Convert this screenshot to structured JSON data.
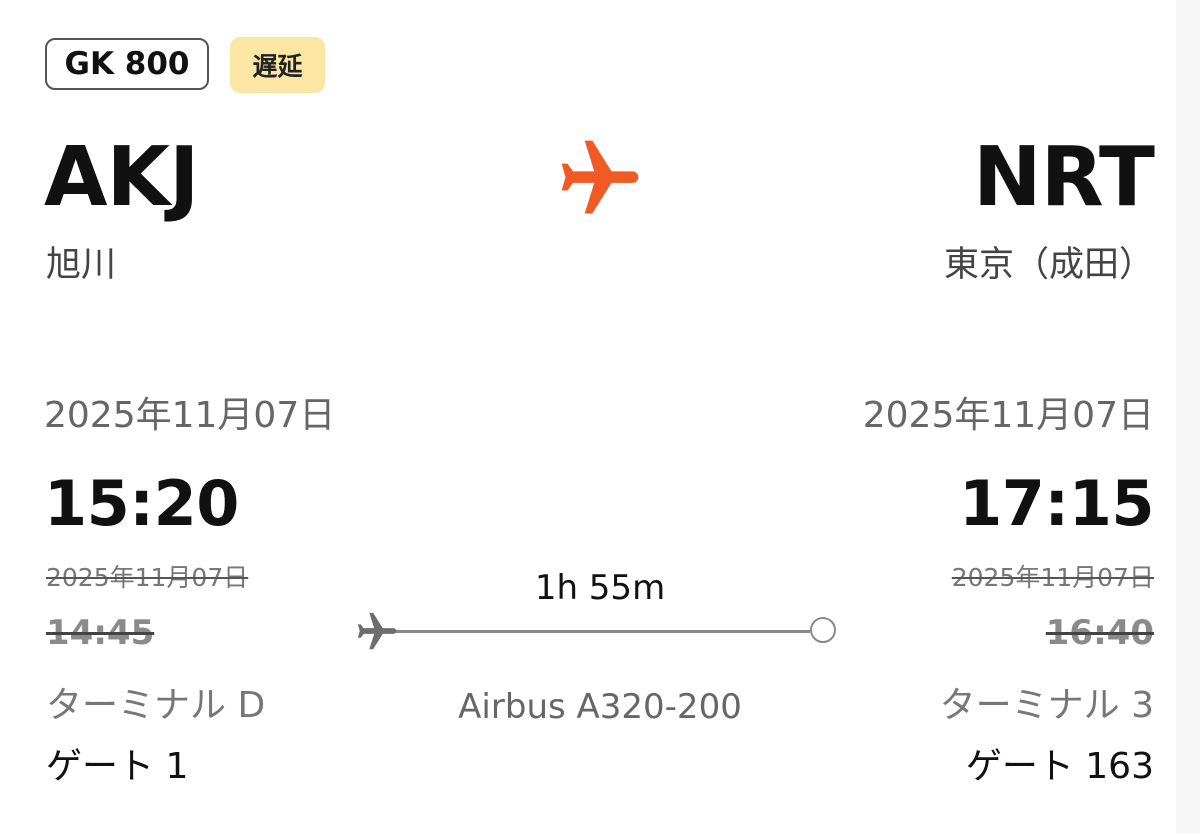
{
  "flight": {
    "number": "GK 800",
    "status": "遅延"
  },
  "colors": {
    "accent": "#f15a24",
    "status_bg": "#fbe7a3"
  },
  "origin": {
    "code": "AKJ",
    "city": "旭川",
    "date": "2025年11月07日",
    "time": "15:20",
    "scheduled_date": "2025年11月07日",
    "scheduled_time": "14:45",
    "terminal": "ターミナル D",
    "gate": "ゲート 1"
  },
  "destination": {
    "code": "NRT",
    "city": "東京（成田）",
    "date": "2025年11月07日",
    "time": "17:15",
    "scheduled_date": "2025年11月07日",
    "scheduled_time": "16:40",
    "terminal": "ターミナル 3",
    "gate": "ゲート 163"
  },
  "route": {
    "duration": "1h 55m",
    "aircraft": "Airbus A320-200",
    "progress_fraction": 0.0,
    "icons": {
      "header": "airplane-icon",
      "progress": "airplane-icon",
      "destination": "circle-icon"
    }
  }
}
